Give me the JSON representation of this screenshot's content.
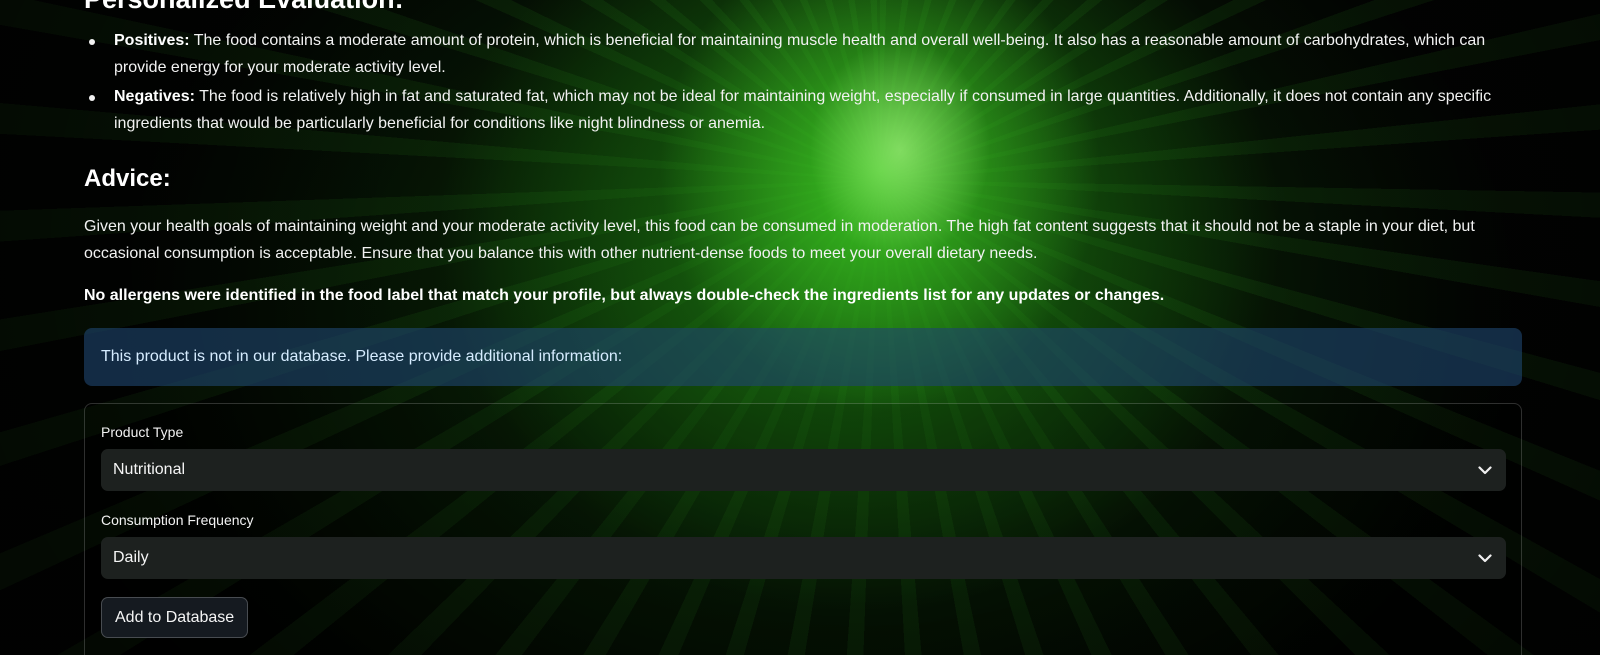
{
  "evaluation": {
    "heading": "Personalized Evaluation:",
    "positives_label": "Positives:",
    "positives_text": " The food contains a moderate amount of protein, which is beneficial for maintaining muscle health and overall well-being. It also has a reasonable amount of carbohydrates, which can provide energy for your moderate activity level.",
    "negatives_label": "Negatives:",
    "negatives_text": " The food is relatively high in fat and saturated fat, which may not be ideal for maintaining weight, especially if consumed in large quantities. Additionally, it does not contain any specific ingredients that would be particularly beneficial for conditions like night blindness or anemia."
  },
  "advice": {
    "title": "Advice:",
    "text": "Given your health goals of maintaining weight and your moderate activity level, this food can be consumed in moderation. The high fat content suggests that it should not be a staple in your diet, but occasional consumption is acceptable. Ensure that you balance this with other nutrient-dense foods to meet your overall dietary needs.",
    "allergen_note": "No allergens were identified in the food label that match your profile, but always double-check the ingredients list for any updates or changes."
  },
  "info_banner": "This product is not in our database. Please provide additional information:",
  "form": {
    "product_type_label": "Product Type",
    "product_type_value": "Nutritional",
    "frequency_label": "Consumption Frequency",
    "frequency_value": "Daily",
    "submit_label": "Add to Database"
  },
  "icons": {
    "dropdown": "chevron-down-icon"
  }
}
